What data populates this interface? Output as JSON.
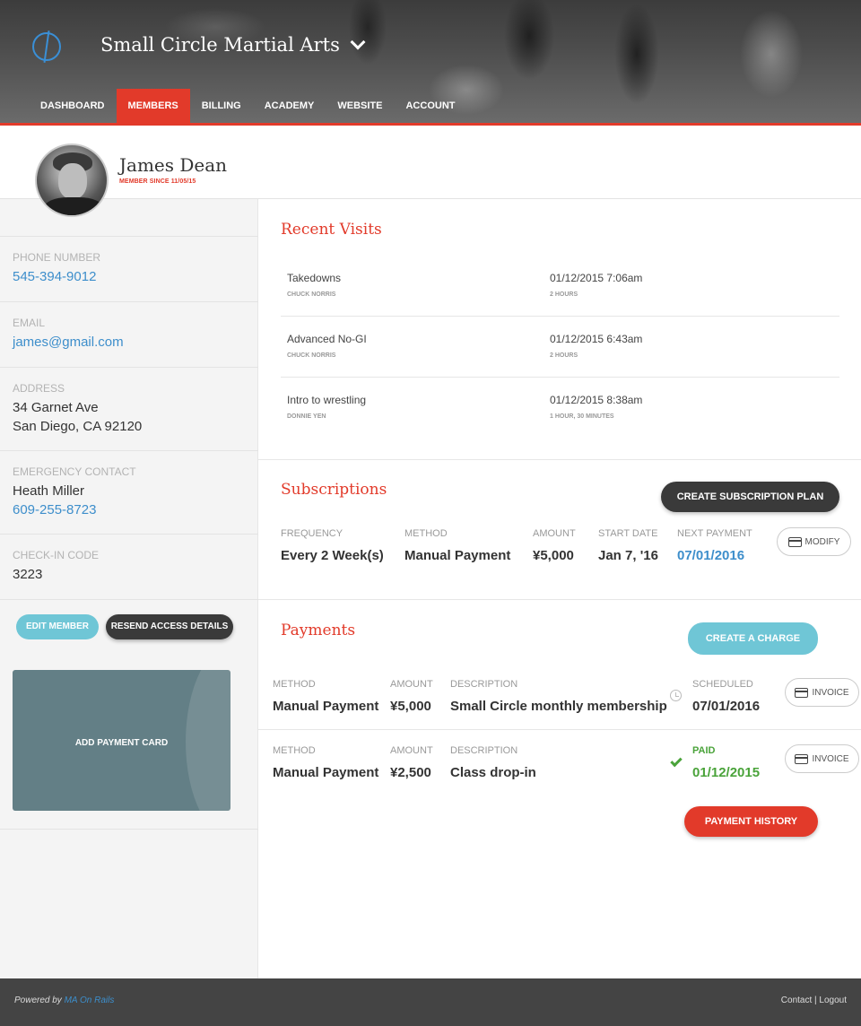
{
  "header": {
    "brand": "Small Circle Martial Arts",
    "nav": [
      "DASHBOARD",
      "MEMBERS",
      "BILLING",
      "ACADEMY",
      "WEBSITE",
      "ACCOUNT"
    ],
    "active_nav": "MEMBERS"
  },
  "member": {
    "name": "James Dean",
    "since": "MEMBER SINCE 11/05/15"
  },
  "sidebar": {
    "phone_label": "PHONE NUMBER",
    "phone": "545-394-9012",
    "email_label": "EMAIL",
    "email": "james@gmail.com",
    "address_label": "ADDRESS",
    "address_line1": "34 Garnet Ave",
    "address_line2": "San Diego, CA 92120",
    "emergency_label": "EMERGENCY CONTACT",
    "emergency_name": "Heath Miller",
    "emergency_phone": "609-255-8723",
    "checkin_label": "CHECK-IN CODE",
    "checkin_code": "3223",
    "edit_member": "EDIT MEMBER",
    "resend_access": "RESEND ACCESS DETAILS",
    "add_payment_card": "ADD PAYMENT CARD"
  },
  "recent_visits": {
    "title": "Recent Visits",
    "items": [
      {
        "class": "Takedowns",
        "instructor": "CHUCK NORRIS",
        "datetime": "01/12/2015 7:06am",
        "duration": "2 HOURS"
      },
      {
        "class": "Advanced No-GI",
        "instructor": "CHUCK NORRIS",
        "datetime": "01/12/2015 6:43am",
        "duration": "2 HOURS"
      },
      {
        "class": "Intro to wrestling",
        "instructor": "DONNIE YEN",
        "datetime": "01/12/2015 8:38am",
        "duration": "1 HOUR, 30 MINUTES"
      }
    ]
  },
  "subscriptions": {
    "title": "Subscriptions",
    "create_button": "CREATE SUBSCRIPTION PLAN",
    "labels": {
      "frequency": "FREQUENCY",
      "method": "METHOD",
      "amount": "AMOUNT",
      "start_date": "START DATE",
      "next_payment": "NEXT PAYMENT"
    },
    "frequency": "Every 2 Week(s)",
    "method": "Manual Payment",
    "amount": "¥5,000",
    "start_date": "Jan 7, '16",
    "next_payment": "07/01/2016",
    "modify_button": "MODIFY"
  },
  "payments": {
    "title": "Payments",
    "create_button": "CREATE A CHARGE",
    "labels": {
      "method": "METHOD",
      "amount": "AMOUNT",
      "description": "DESCRIPTION"
    },
    "items": [
      {
        "method": "Manual Payment",
        "amount": "¥5,000",
        "description": "Small Circle monthly membership",
        "status": "SCHEDULED",
        "date": "07/01/2016",
        "invoice": "INVOICE",
        "status_icon": "clock-icon"
      },
      {
        "method": "Manual Payment",
        "amount": "¥2,500",
        "description": "Class drop-in",
        "status": "PAID",
        "date": "01/12/2015",
        "invoice": "INVOICE",
        "status_icon": "check-icon"
      }
    ],
    "history_button": "PAYMENT HISTORY"
  },
  "footer": {
    "powered_by": "Powered by",
    "powered_link": "MA On Rails",
    "links": "Contact | Logout"
  },
  "colors": {
    "accent": "#e23a2a",
    "link": "#3d8ecb",
    "teal": "#6fc6d6",
    "paid": "#4aa33a"
  }
}
